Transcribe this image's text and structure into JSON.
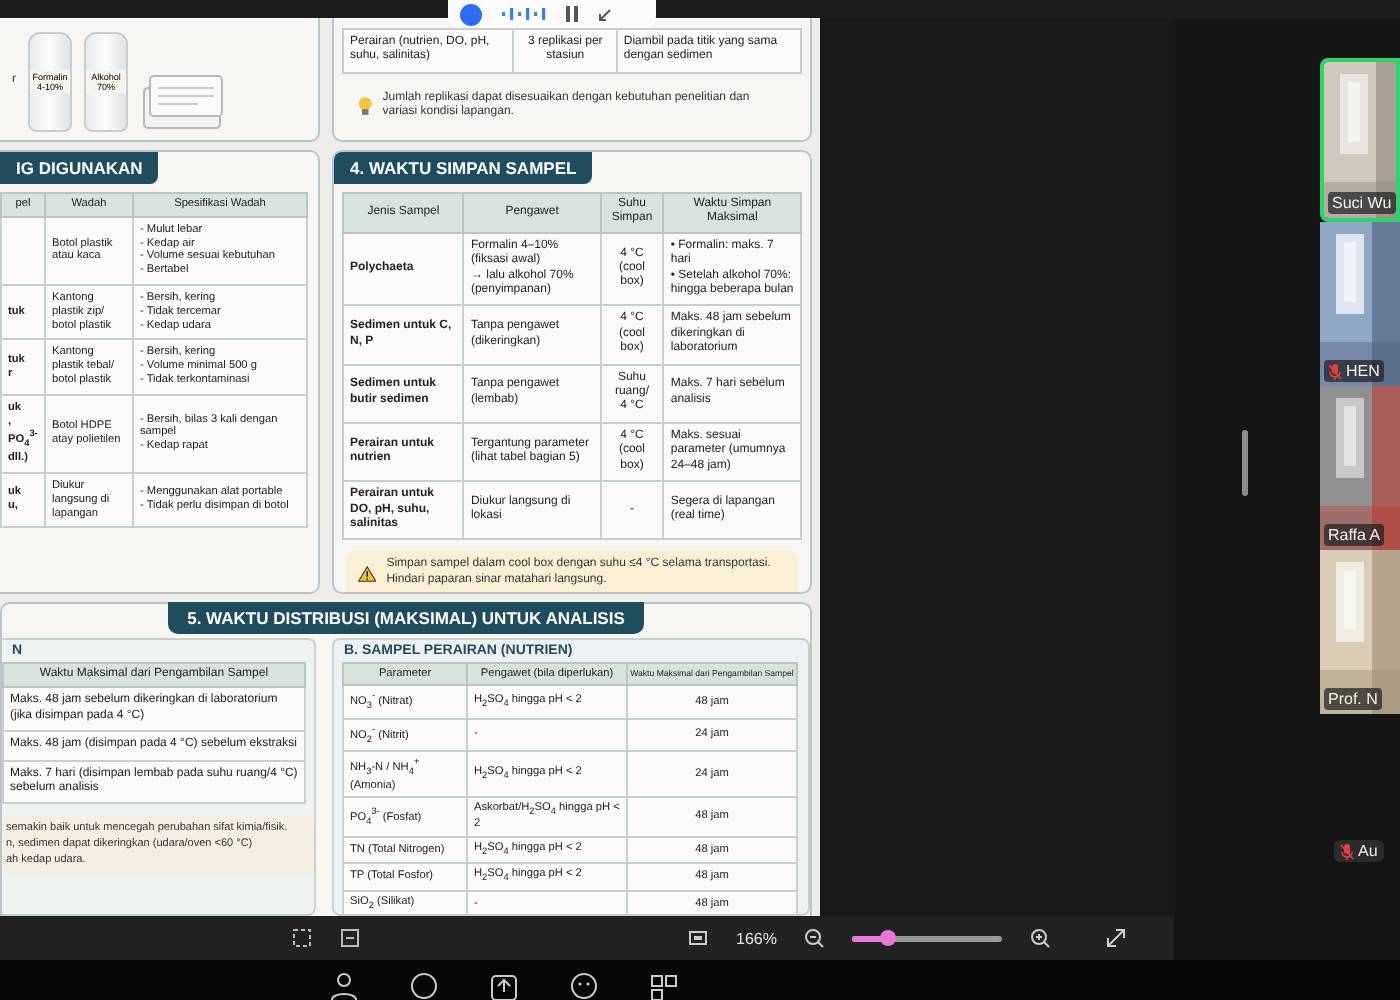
{
  "top_left_card": {
    "text_fragment": "r",
    "bottles": [
      {
        "label": "Formalin 4-10%"
      },
      {
        "label": "Alkohol 70%"
      }
    ]
  },
  "replication_card": {
    "row": [
      "Perairan (nutrien, DO, pH, suhu, salinitas)",
      "3 replikasi per stasiun",
      "Diambil pada titik yang sama dengan sedimen"
    ],
    "tip": "Jumlah replikasi dapat disesuaikan dengan kebutuhan penelitian dan variasi kondisi lapangan."
  },
  "container_card": {
    "title": "IG DIGUNAKAN",
    "columns": [
      "pel",
      "Wadah",
      "Spesifikasi Wadah"
    ],
    "rows": [
      {
        "column_1": "",
        "wadah": "Botol plastik atau kaca",
        "spesifikasi": [
          "- Mulut lebar",
          "- Kedap air",
          "- Volume sesuai kebutuhan",
          "- Bertabel"
        ]
      },
      {
        "column_1": "tuk",
        "wadah": "Kantong plastik zip/ botol plastik",
        "spesifikasi": [
          "- Bersih, kering",
          "- Tidak tercemar",
          "- Kedap udara"
        ]
      },
      {
        "column_1": "tuk\nr",
        "wadah": "Kantong plastik tebal/ botol plastik",
        "spesifikasi": [
          "- Bersih, kering",
          "- Volume minimal 500 g",
          "- Tidak terkontaminasi"
        ]
      },
      {
        "column_1": "uk\n, PO$_{4}$$^{3-}$\ndll.)",
        "wadah": "Botol HDPE atay polietilen",
        "spesifikasi": [
          "- Bersih, bilas 3 kali dengan sampel",
          "- Kedap rapat"
        ]
      },
      {
        "column_1": "uk\nu,",
        "wadah": "Diukur langsung di lapangan",
        "spesifikasi": [
          "- Menggunakan alat portable",
          "- Tidak perlu disimpan di botol"
        ]
      }
    ]
  },
  "storage_card": {
    "title": "4. WAKTU SIMPAN SAMPEL",
    "columns": [
      "Jenis Sampel",
      "Pengawet",
      "Suhu Simpan",
      "Waktu Simpan Maksimal"
    ],
    "rows": [
      {
        "jenis": "Polychaeta",
        "pengawet": "Formalin 4–10%\n(fiksasi awal)\n→ lalu alkohol 70%\n(penyimpanan)",
        "suhu": "4 °C\n(cool box)",
        "waktu": [
          "• Formalin: maks. 7 hari",
          "• Setelah alkohol 70%: hingga beberapa bulan"
        ]
      },
      {
        "jenis": "Sedimen untuk C, N, P",
        "pengawet": "Tanpa pengawet (dikeringkan)",
        "suhu": "4 °C\n(cool box)",
        "waktu": "Maks. 48 jam sebelum dikeringkan di laboratorium"
      },
      {
        "jenis": "Sedimen untuk butir sedimen",
        "pengawet": "Tanpa pengawet (lembab)",
        "suhu": "Suhu ruang/\n4 °C",
        "waktu": "Maks. 7 hari sebelum analisis"
      },
      {
        "jenis": "Perairan untuk nutrien",
        "pengawet": "Tergantung parameter (lihat tabel bagian 5)",
        "suhu": "4 °C\n(cool box)",
        "waktu": "Maks. sesuai parameter (umumnya 24–48 jam)"
      },
      {
        "jenis": "Perairan untuk DO, pH, suhu, salinitas",
        "pengawet": "Diukur langsung di lokasi",
        "suhu": "-",
        "waktu": "Segera di lapangan (real time)"
      }
    ],
    "warning": "Simpan sampel dalam cool box dengan suhu ≤4 °C selama transportasi. Hindari paparan sinar matahari langsung."
  },
  "distribution_section": {
    "title": "5. WAKTU DISTRIBUSI (MAKSIMAL) UNTUK ANALISIS",
    "left_panel": {
      "title": "N",
      "column": "Waktu Maksimal dari Pengambilan Sampel",
      "rows": [
        "Maks. 48 jam sebelum dikeringkan di laboratorium (jika disimpan pada 4 °C)",
        "Maks. 48 jam (disimpan pada 4 °C) sebelum ekstraksi",
        "Maks. 7 hari (disimpan lembab pada suhu ruang/4 °C) sebelum analisis"
      ],
      "note": [
        "semakin baik untuk mencegah perubahan sifat kimia/fisik.",
        "n, sedimen dapat dikeringkan (udara/oven <60 °C)",
        "ah kedap udara."
      ]
    },
    "right_panel": {
      "title": "B. SAMPEL PERAIRAN (NUTRIEN)",
      "columns": [
        "Parameter",
        "Pengawet (bila diperlukan)",
        "Waktu Maksimal dari Pengambilan Sampel"
      ],
      "rows": [
        [
          "NO$_{3}$$^{-}$ (Nitrat)",
          "H$_{2}$SO$_{4}$ hingga pH < 2",
          "48 jam"
        ],
        [
          "NO$_{2}$$^{-}$ (Nitrit)",
          "-",
          "24 jam"
        ],
        [
          "NH$_{3}$-N / NH$_{4}$$^{+}$ (Amonia)",
          "H$_{2}$SO$_{4}$ hingga pH < 2",
          "24 jam"
        ],
        [
          "PO$_{4}$$^{3-}$ (Fosfat)",
          "Askorbat/H$_{2}$SO$_{4}$ hingga pH < 2",
          "48 jam"
        ],
        [
          "TN (Total Nitrogen)",
          "H$_{2}$SO$_{4}$ hingga pH < 2",
          "48 jam"
        ],
        [
          "TP (Total Fosfor)",
          "H$_{2}$SO$_{4}$ hingga pH < 2",
          "48 jam"
        ],
        [
          "SiO$_{2}$ (Silikat)",
          "-",
          "48 jam"
        ]
      ]
    }
  },
  "viewer_toolbar": {
    "zoom_label": "166%",
    "zoom_slider": {
      "level": 0.24
    }
  },
  "participants": [
    {
      "name": "Suci Wu",
      "speaking": true,
      "muted": false
    },
    {
      "name": "HEN",
      "speaking": false,
      "muted": true
    },
    {
      "name": "Raffa A",
      "speaking": false,
      "muted": false
    },
    {
      "name": "Prof. N",
      "speaking": false,
      "muted": false
    }
  ],
  "audio_only": [
    {
      "name": "Au",
      "muted": true
    }
  ]
}
